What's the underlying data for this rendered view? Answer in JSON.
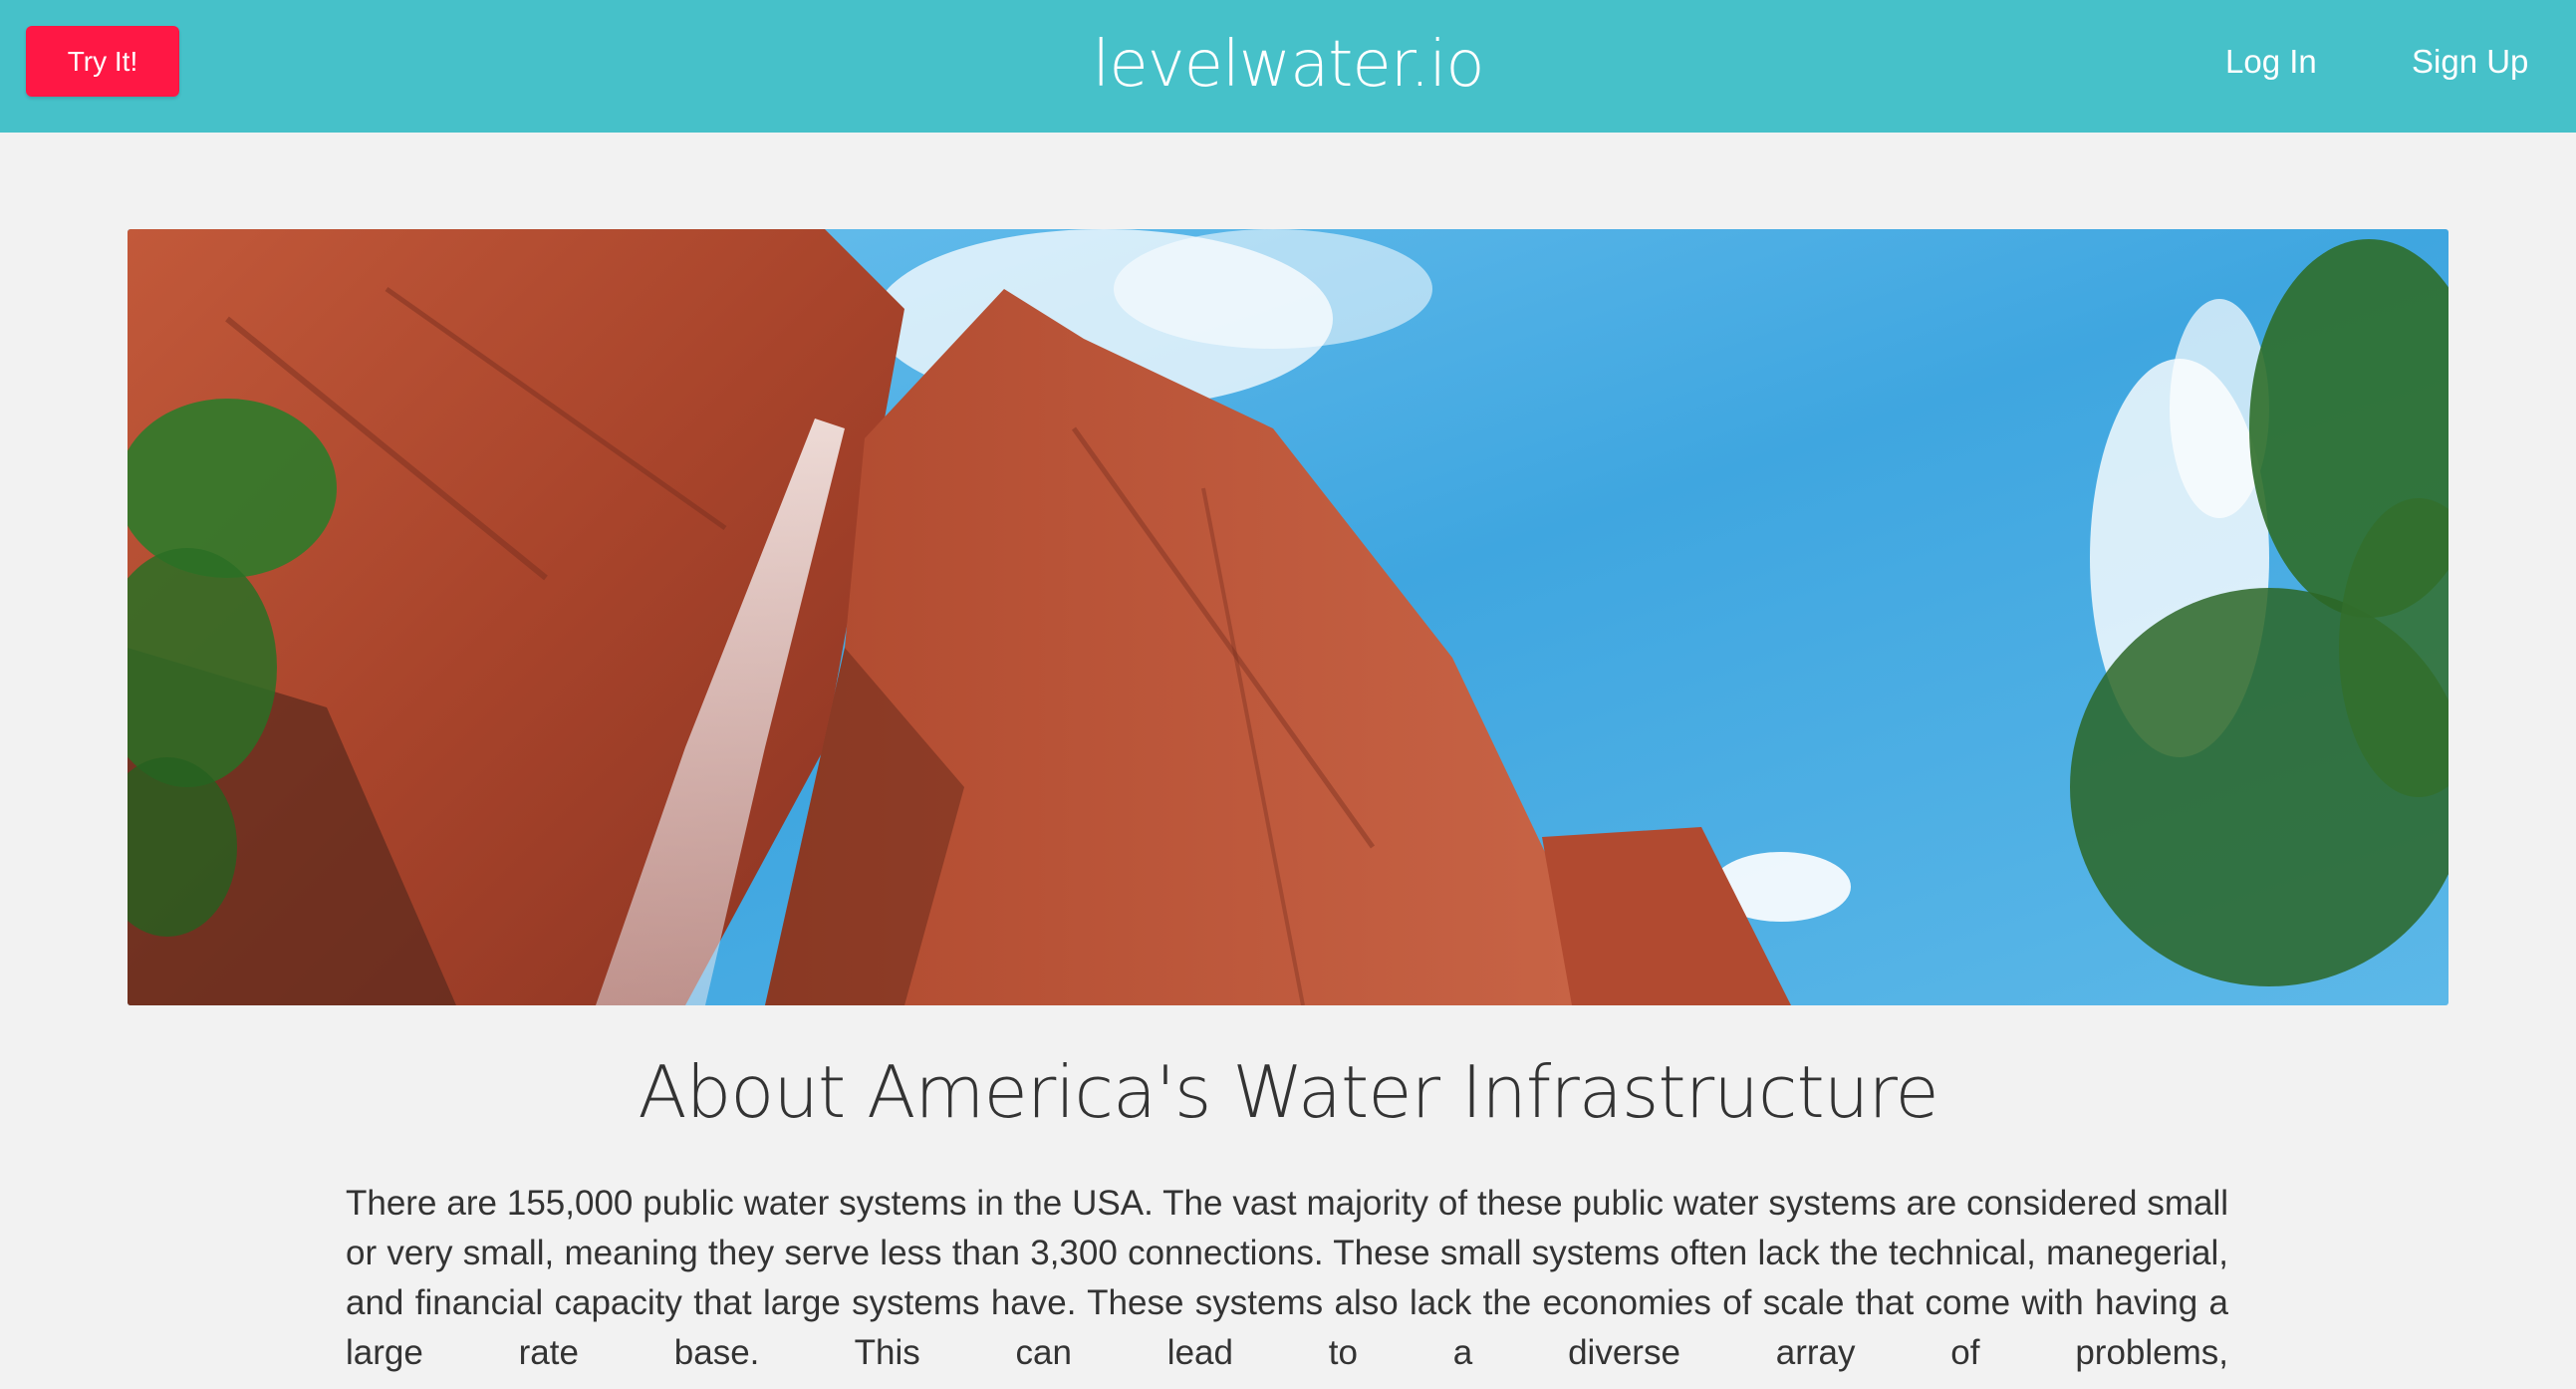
{
  "navbar": {
    "cta_label": "Try It!",
    "brand": "levelwater.io",
    "login_label": "Log In",
    "signup_label": "Sign Up",
    "background_color": "#46c1c9",
    "cta_color": "#ff1744"
  },
  "hero": {
    "image_description_icon": "canyon-waterfall-image"
  },
  "about": {
    "title": "About America's Water Infrastructure",
    "body": "There are 155,000 public water systems in the USA. The vast majority of these public water systems are considered small or very small, meaning they serve less than 3,300 connections. These small systems often lack the technical, manegerial, and financial capacity that large systems have. These systems also lack the economies of scale that come with having a large rate base. This can lead to a diverse array of problems,"
  }
}
